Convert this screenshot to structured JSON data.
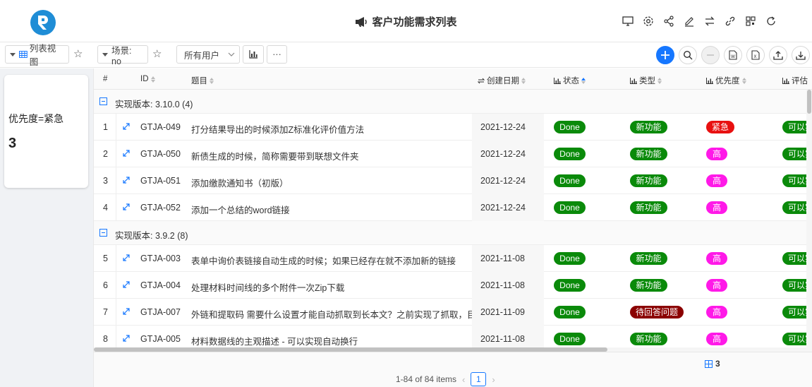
{
  "header": {
    "title": "客户功能需求列表",
    "logo_letter": "R",
    "icons": [
      "monitor-icon",
      "settings-icon",
      "share-icon",
      "edit-icon",
      "swap-icon",
      "link-icon",
      "qrcode-icon",
      "refresh-icon"
    ]
  },
  "toolbar": {
    "view_label": "列表视图",
    "scene_label": "场景: no",
    "user_filter": "所有用户",
    "more_label": "···"
  },
  "card": {
    "label": "优先度=紧急",
    "value": "3"
  },
  "table": {
    "headers": {
      "index": "#",
      "id": "ID",
      "title": "题目",
      "date": "创建日期",
      "status": "状态",
      "type": "类型",
      "priority": "优先度",
      "eval": "评估"
    },
    "groups": [
      {
        "label": "实现版本: 3.10.0 (4)",
        "rows": [
          {
            "n": "1",
            "id": "GTJA-049",
            "title": "打分结果导出的时候添加Z标准化评价值方法",
            "date": "2021-12-24",
            "status": "Done",
            "type": "新功能",
            "priority": "紧急",
            "eval": "可以实现"
          },
          {
            "n": "2",
            "id": "GTJA-050",
            "title": "新债生成的时候，简称需要带到联想文件夹",
            "date": "2021-12-24",
            "status": "Done",
            "type": "新功能",
            "priority": "高",
            "eval": "可以实现"
          },
          {
            "n": "3",
            "id": "GTJA-051",
            "title": "添加缴款通知书（初版）",
            "date": "2021-12-24",
            "status": "Done",
            "type": "新功能",
            "priority": "高",
            "eval": "可以实现"
          },
          {
            "n": "4",
            "id": "GTJA-052",
            "title": "添加一个总结的word链接",
            "date": "2021-12-24",
            "status": "Done",
            "type": "新功能",
            "priority": "高",
            "eval": "可以实现"
          }
        ]
      },
      {
        "label": "实现版本: 3.9.2 (8)",
        "rows": [
          {
            "n": "5",
            "id": "GTJA-003",
            "title": "表单中询价表链接自动生成的时候；如果已经存在就不添加新的链接",
            "date": "2021-11-08",
            "status": "Done",
            "type": "新功能",
            "priority": "高",
            "eval": "可以实现"
          },
          {
            "n": "6",
            "id": "GTJA-004",
            "title": "处理材料时间线的多个附件一次Zip下载",
            "date": "2021-11-08",
            "status": "Done",
            "type": "新功能",
            "priority": "高",
            "eval": "可以实现"
          },
          {
            "n": "7",
            "id": "GTJA-007",
            "title": "外链和提取码 需要什么设置才能自动抓取到长本文？之前实现了抓取，目前",
            "date": "2021-11-09",
            "status": "Done",
            "type": "待回答问题",
            "priority": "高",
            "eval": "可以实现"
          },
          {
            "n": "8",
            "id": "GTJA-005",
            "title": "材料数据线的主观描述 - 可以实现自动换行",
            "date": "2021-11-08",
            "status": "Done",
            "type": "新功能",
            "priority": "高",
            "eval": "可以实现"
          }
        ]
      }
    ]
  },
  "colors": {
    "done": "#0a8a0a",
    "new_feature": "#0a8a0a",
    "question": "#8b0000",
    "urgent": "#e81010",
    "high": "#ff19e8",
    "eval": "#0a8a0a",
    "accent": "#1677ff"
  },
  "footer": {
    "sum_value": "3",
    "items_text": "1-84 of 84 items",
    "page": "1"
  }
}
